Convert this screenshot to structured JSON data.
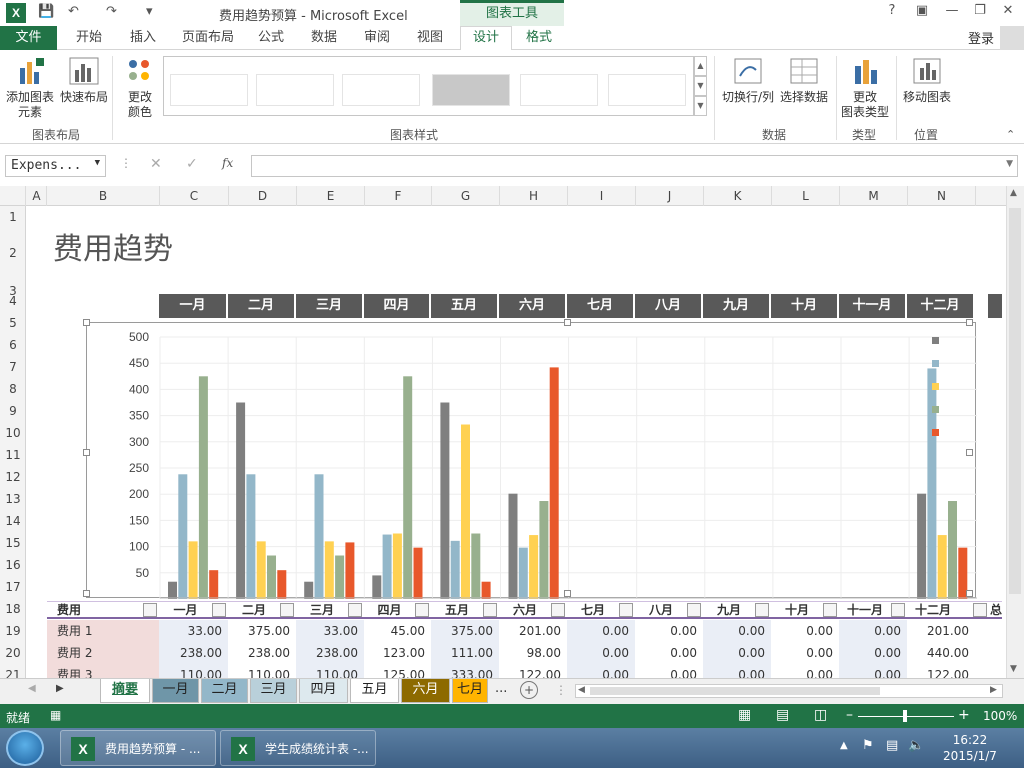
{
  "window": {
    "title": "费用趋势预算 - Microsoft Excel",
    "context_tab": "图表工具",
    "help": "?",
    "app_icon": "X"
  },
  "tabs": {
    "file": "文件",
    "items": [
      "开始",
      "插入",
      "页面布局",
      "公式",
      "数据",
      "审阅",
      "视图"
    ],
    "design": "设计",
    "format": "格式",
    "signin": "登录"
  },
  "ribbon": {
    "add_element": [
      "添加图表",
      "元素"
    ],
    "quick_layout": "快速布局",
    "change_color": [
      "更改",
      "颜色"
    ],
    "switch_row_col": "切换行/列",
    "select_data": "选择数据",
    "change_type": [
      "更改",
      "图表类型"
    ],
    "move_chart": "移动图表",
    "groups": {
      "layout": "图表布局",
      "styles": "图表样式",
      "data": "数据",
      "type": "类型",
      "location": "位置"
    }
  },
  "formula_bar": {
    "name_box": "Expens...",
    "fx": "fx"
  },
  "columns": [
    "A",
    "B",
    "C",
    "D",
    "E",
    "F",
    "G",
    "H",
    "I",
    "J",
    "K",
    "L",
    "M",
    "N"
  ],
  "rows": [
    "1",
    "2",
    "3",
    "4",
    "5",
    "6",
    "7",
    "8",
    "9",
    "10",
    "11",
    "12",
    "13",
    "14",
    "15",
    "16",
    "17",
    "18",
    "19",
    "20",
    "21"
  ],
  "sheet": {
    "title": "费用趋势"
  },
  "months": [
    "一月",
    "二月",
    "三月",
    "四月",
    "五月",
    "六月",
    "七月",
    "八月",
    "九月",
    "十月",
    "十一月",
    "十二月"
  ],
  "chart_data": {
    "type": "bar",
    "categories": [
      "一月",
      "二月",
      "三月",
      "四月",
      "五月",
      "六月",
      "七月",
      "八月",
      "九月",
      "十月",
      "十一月",
      "十二月"
    ],
    "ylim": [
      0,
      500
    ],
    "yticks": [
      "500",
      "450",
      "400",
      "350",
      "300",
      "250",
      "200",
      "150",
      "100",
      "50"
    ],
    "grid": true,
    "series": [
      {
        "color": "#7f7f7f",
        "values": [
          33,
          375,
          33,
          45,
          375,
          201,
          0,
          0,
          0,
          0,
          0,
          201
        ]
      },
      {
        "color": "#93b7c9",
        "values": [
          238,
          238,
          238,
          123,
          111,
          98,
          0,
          0,
          0,
          0,
          0,
          440
        ]
      },
      {
        "color": "#ffd152",
        "values": [
          110,
          110,
          110,
          125,
          333,
          122,
          0,
          0,
          0,
          0,
          0,
          122
        ]
      },
      {
        "color": "#98b08e",
        "values": [
          425,
          83,
          83,
          425,
          125,
          187,
          0,
          0,
          0,
          0,
          0,
          187
        ]
      },
      {
        "color": "#e8582b",
        "values": [
          55,
          55,
          108,
          98,
          33,
          442,
          0,
          0,
          0,
          0,
          0,
          98
        ]
      }
    ]
  },
  "table": {
    "header": "费用",
    "rows": [
      {
        "name": "费用 1",
        "values": [
          "33.00",
          "375.00",
          "33.00",
          "45.00",
          "375.00",
          "201.00",
          "0.00",
          "0.00",
          "0.00",
          "0.00",
          "0.00",
          "201.00"
        ]
      },
      {
        "name": "费用 2",
        "values": [
          "238.00",
          "238.00",
          "238.00",
          "123.00",
          "111.00",
          "98.00",
          "0.00",
          "0.00",
          "0.00",
          "0.00",
          "0.00",
          "440.00"
        ]
      },
      {
        "name": "费用 3",
        "values": [
          "110.00",
          "110.00",
          "110.00",
          "125.00",
          "333.00",
          "122.00",
          "0.00",
          "0.00",
          "0.00",
          "0.00",
          "0.00",
          "122.00"
        ]
      }
    ],
    "overflow_header": "总"
  },
  "sheet_tabs": [
    {
      "label": "摘要",
      "bg": "#ffffff",
      "color": "#217346"
    },
    {
      "label": "一月",
      "bg": "#6f96a8",
      "color": "#222"
    },
    {
      "label": "二月",
      "bg": "#93b7c9",
      "color": "#222"
    },
    {
      "label": "三月",
      "bg": "#b9d0da",
      "color": "#222"
    },
    {
      "label": "四月",
      "bg": "#dde9ee",
      "color": "#222"
    },
    {
      "label": "五月",
      "bg": "#ffffff",
      "color": "#222"
    },
    {
      "label": "六月",
      "bg": "#8d6a00",
      "color": "#fff"
    },
    {
      "label": "七月",
      "bg": "#ffb400",
      "color": "#222"
    }
  ],
  "sheet_tabs_more": "...",
  "status": {
    "ready": "就绪",
    "zoom": "100%"
  },
  "taskbar": {
    "items": [
      "费用趋势预算 - ...",
      "学生成绩统计表 -..."
    ],
    "time": "16:22",
    "date": "2015/1/7"
  }
}
